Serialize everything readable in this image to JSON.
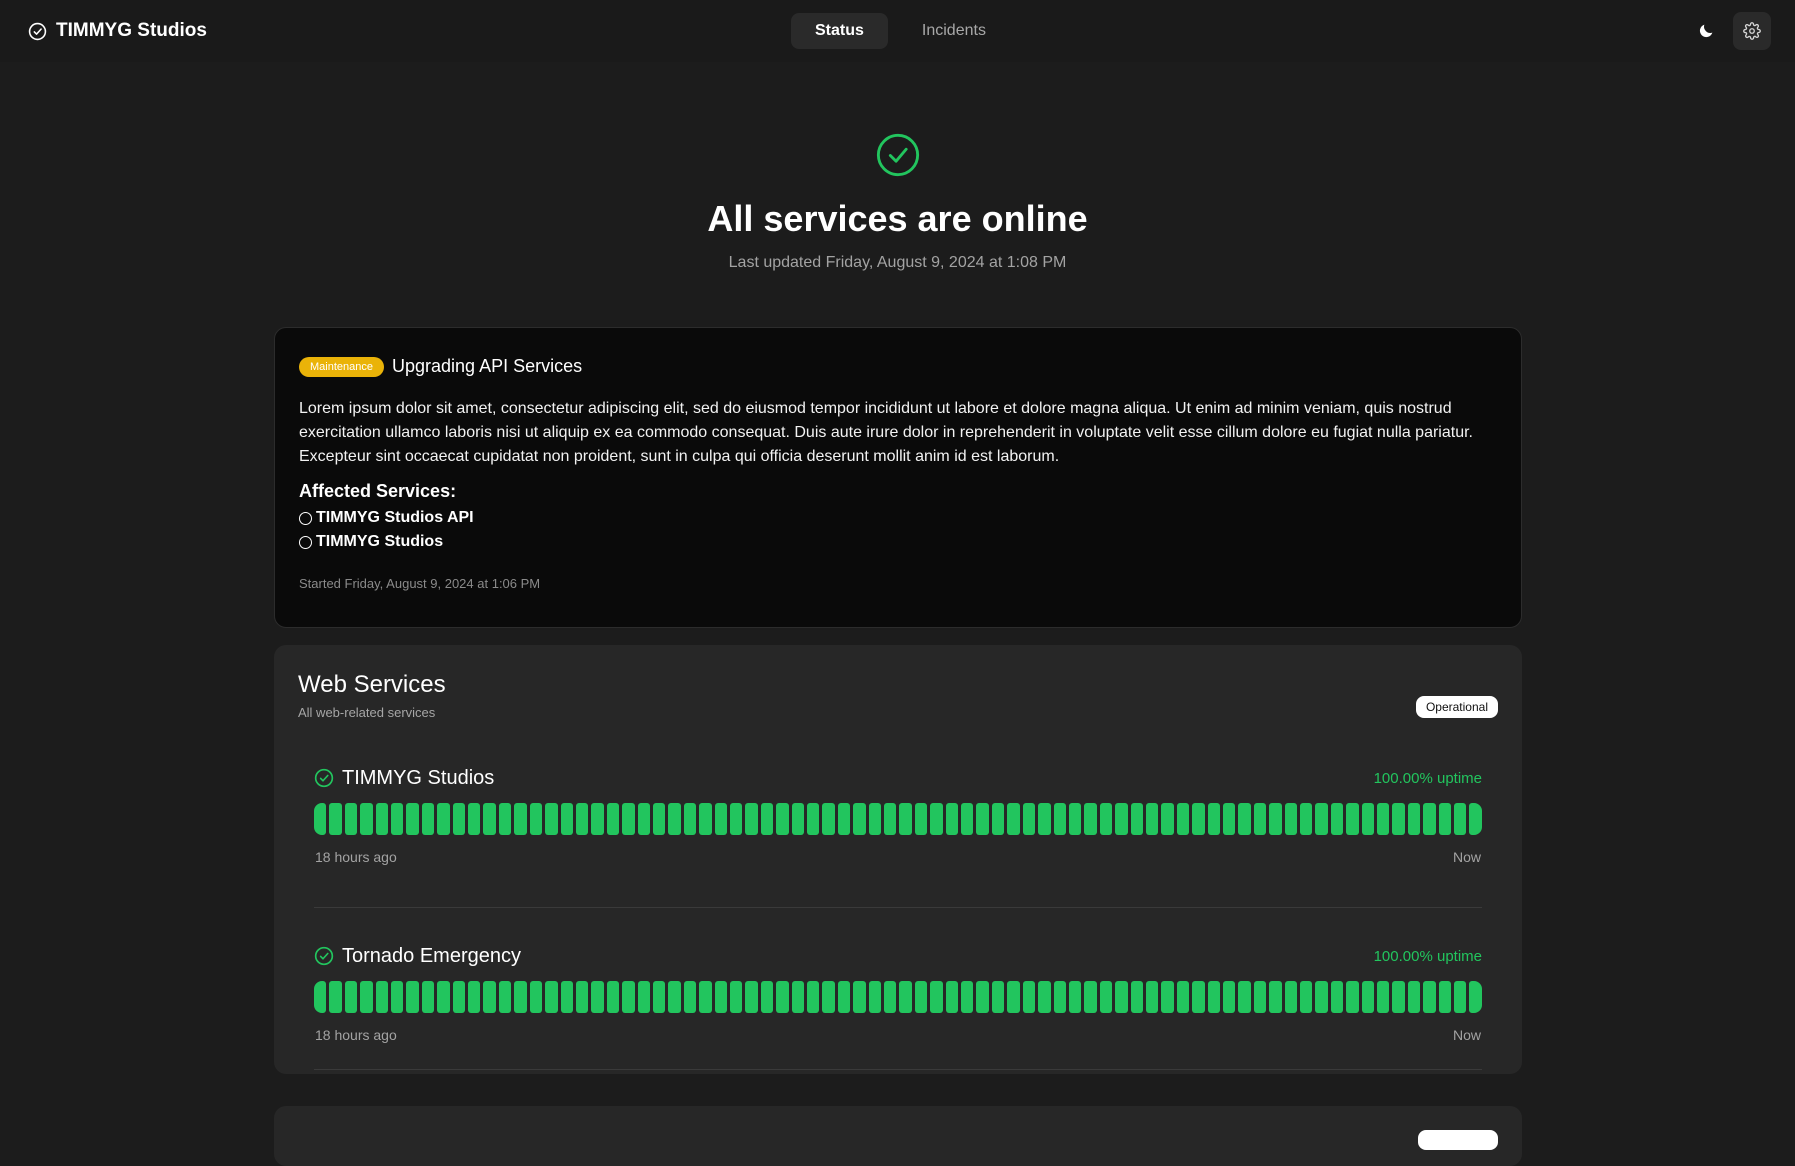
{
  "header": {
    "brand": "TIMMYG Studios",
    "tabs": [
      {
        "label": "Status",
        "active": true
      },
      {
        "label": "Incidents",
        "active": false
      }
    ]
  },
  "hero": {
    "title": "All services are online",
    "updated": "Last updated Friday, August 9, 2024 at 1:08 PM"
  },
  "maintenance": {
    "badge": "Maintenance",
    "title": "Upgrading API Services",
    "body": "Lorem ipsum dolor sit amet, consectetur adipiscing elit, sed do eiusmod tempor incididunt ut labore et dolore magna aliqua. Ut enim ad minim veniam, quis nostrud exercitation ullamco laboris nisi ut aliquip ex ea commodo consequat. Duis aute irure dolor in reprehenderit in voluptate velit esse cillum dolore eu fugiat nulla pariatur. Excepteur sint occaecat cupidatat non proident, sunt in culpa qui officia deserunt mollit anim id est laborum.",
    "affected_title": "Affected Services:",
    "affected": [
      "TIMMYG Studios API",
      "TIMMYG Studios"
    ],
    "started": "Started Friday, August 9, 2024 at 1:06 PM"
  },
  "group": {
    "title": "Web Services",
    "subtitle": "All web-related services",
    "status": "Operational",
    "services": [
      {
        "name": "TIMMYG Studios",
        "uptime": "100.00% uptime",
        "start_label": "18 hours ago",
        "end_label": "Now"
      },
      {
        "name": "Tornado Emergency",
        "uptime": "100.00% uptime",
        "start_label": "18 hours ago",
        "end_label": "Now"
      }
    ]
  },
  "colors": {
    "operational": "#22c55e",
    "maintenance": "#eab308",
    "background": "#1c1c1c",
    "card": "#272727"
  },
  "icons": {
    "brand": "check-circle-icon",
    "theme": "moon-icon",
    "settings": "gear-icon"
  }
}
